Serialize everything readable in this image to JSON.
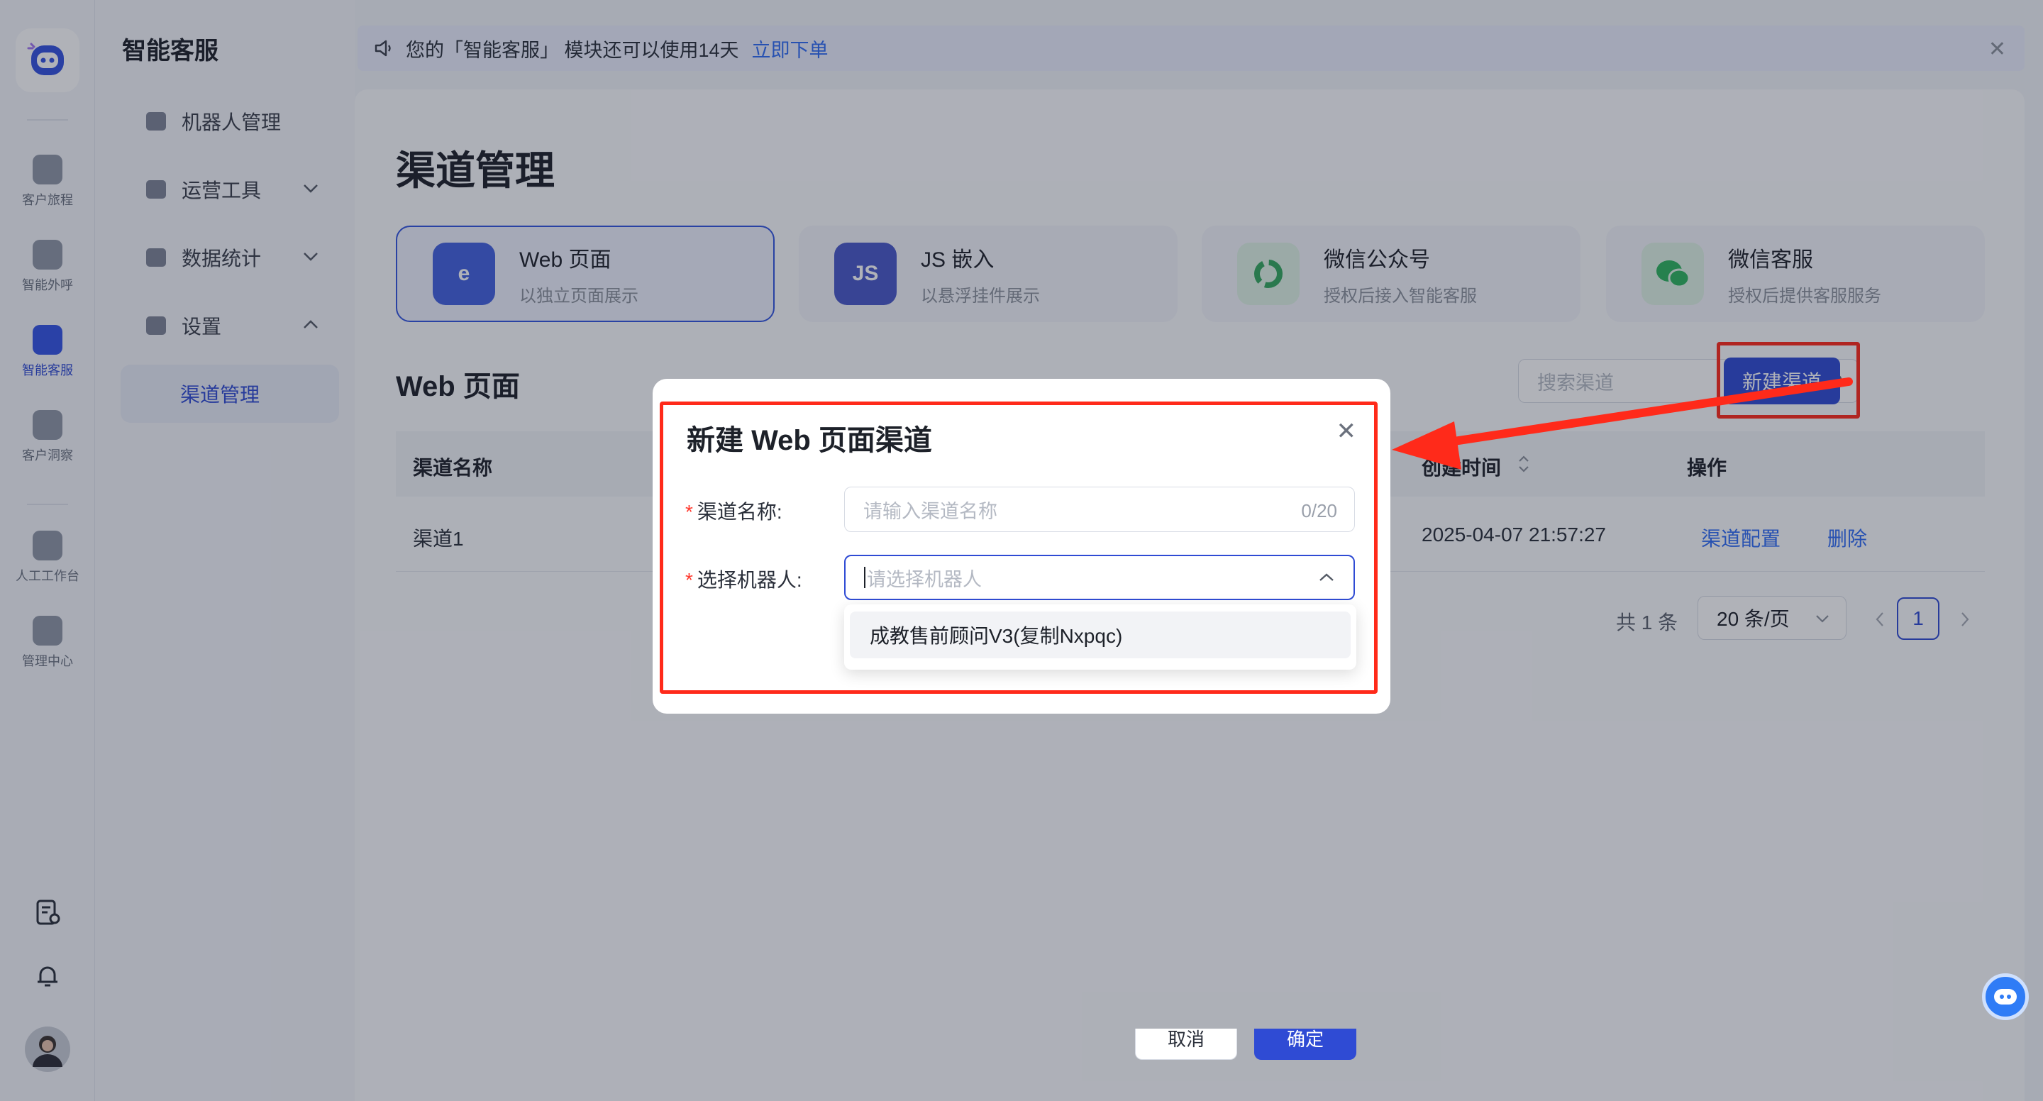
{
  "rail": {
    "items": [
      {
        "label": "客户旅程",
        "icon": "map-pin-icon"
      },
      {
        "label": "智能外呼",
        "icon": "user-call-icon"
      },
      {
        "label": "智能客服",
        "icon": "robot-icon"
      },
      {
        "label": "客户洞察",
        "icon": "insight-icon"
      },
      {
        "label": "人工工作台",
        "icon": "workbench-icon"
      },
      {
        "label": "管理中心",
        "icon": "monitor-icon"
      }
    ]
  },
  "menu": {
    "title": "智能客服",
    "items": [
      "机器人管理",
      "运营工具",
      "数据统计",
      "设置",
      "渠道管理"
    ]
  },
  "banner": {
    "text": "您的「智能客服」 模块还可以使用14天",
    "link": "立即下单"
  },
  "page": {
    "title": "渠道管理",
    "section_title": "Web 页面"
  },
  "channels": [
    {
      "name": "Web 页面",
      "desc": "以独立页面展示",
      "icon": "web-page-icon",
      "color": "#3f5fdc"
    },
    {
      "name": "JS 嵌入",
      "desc": "以悬浮挂件展示",
      "icon": "js-icon",
      "color": "#4a58c8"
    },
    {
      "name": "微信公众号",
      "desc": "授权后接入智能客服",
      "icon": "wechat-official-icon",
      "color": "#3fb26b"
    },
    {
      "name": "微信客服",
      "desc": "授权后提供客服服务",
      "icon": "wechat-kefu-icon",
      "color": "#2eb55f"
    }
  ],
  "toolbar": {
    "search_placeholder": "搜索渠道",
    "new_button": "新建渠道"
  },
  "table": {
    "headers": [
      "渠道名称",
      "创建时间",
      "操作"
    ],
    "rows": [
      {
        "name": "渠道1",
        "created": "2025-04-07 21:57:27",
        "actions": [
          "渠道配置",
          "删除"
        ]
      }
    ]
  },
  "pagination": {
    "total": "共 1 条",
    "page_size": "20 条/页",
    "current": "1"
  },
  "modal": {
    "title": "新建 Web 页面渠道",
    "name_label": "渠道名称:",
    "name_placeholder": "请输入渠道名称",
    "name_count": "0/20",
    "robot_label": "选择机器人:",
    "robot_placeholder": "请选择机器人",
    "options": [
      "成教售前顾问V3(复制Nxpqc)"
    ],
    "cancel": "取消",
    "confirm": "确定"
  }
}
